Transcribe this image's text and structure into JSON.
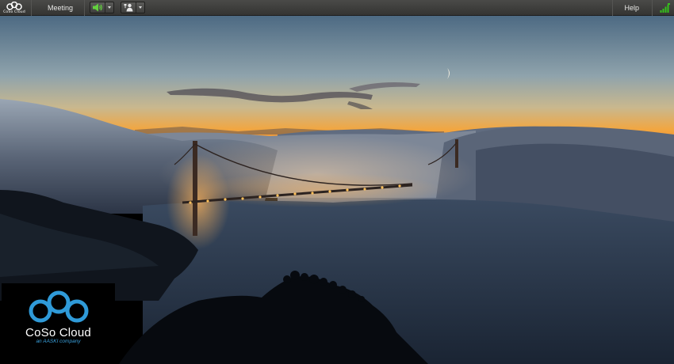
{
  "toolbar": {
    "logo": {
      "icon": "coso-cloud-logo-icon",
      "text": "CoSo Cloud"
    },
    "meeting_label": "Meeting",
    "audio_button": {
      "icon": "speaker-icon",
      "dropdown_icon": "chevron-down-icon"
    },
    "camera_button": {
      "icon": "webcam-person-icon",
      "dropdown_icon": "chevron-down-icon"
    },
    "help_label": "Help",
    "connection_icon": "signal-strength-icon"
  },
  "stage": {
    "image": "golden-gate-bridge-fog-sunset"
  },
  "brand": {
    "name": "CoSo Cloud",
    "tagline": "an AASKI company",
    "accent": "#2f9ad8"
  },
  "colors": {
    "toolbar_bg": "#3e3e3c",
    "speaker_green": "#63d13e",
    "signal_green": "#35c21b"
  }
}
